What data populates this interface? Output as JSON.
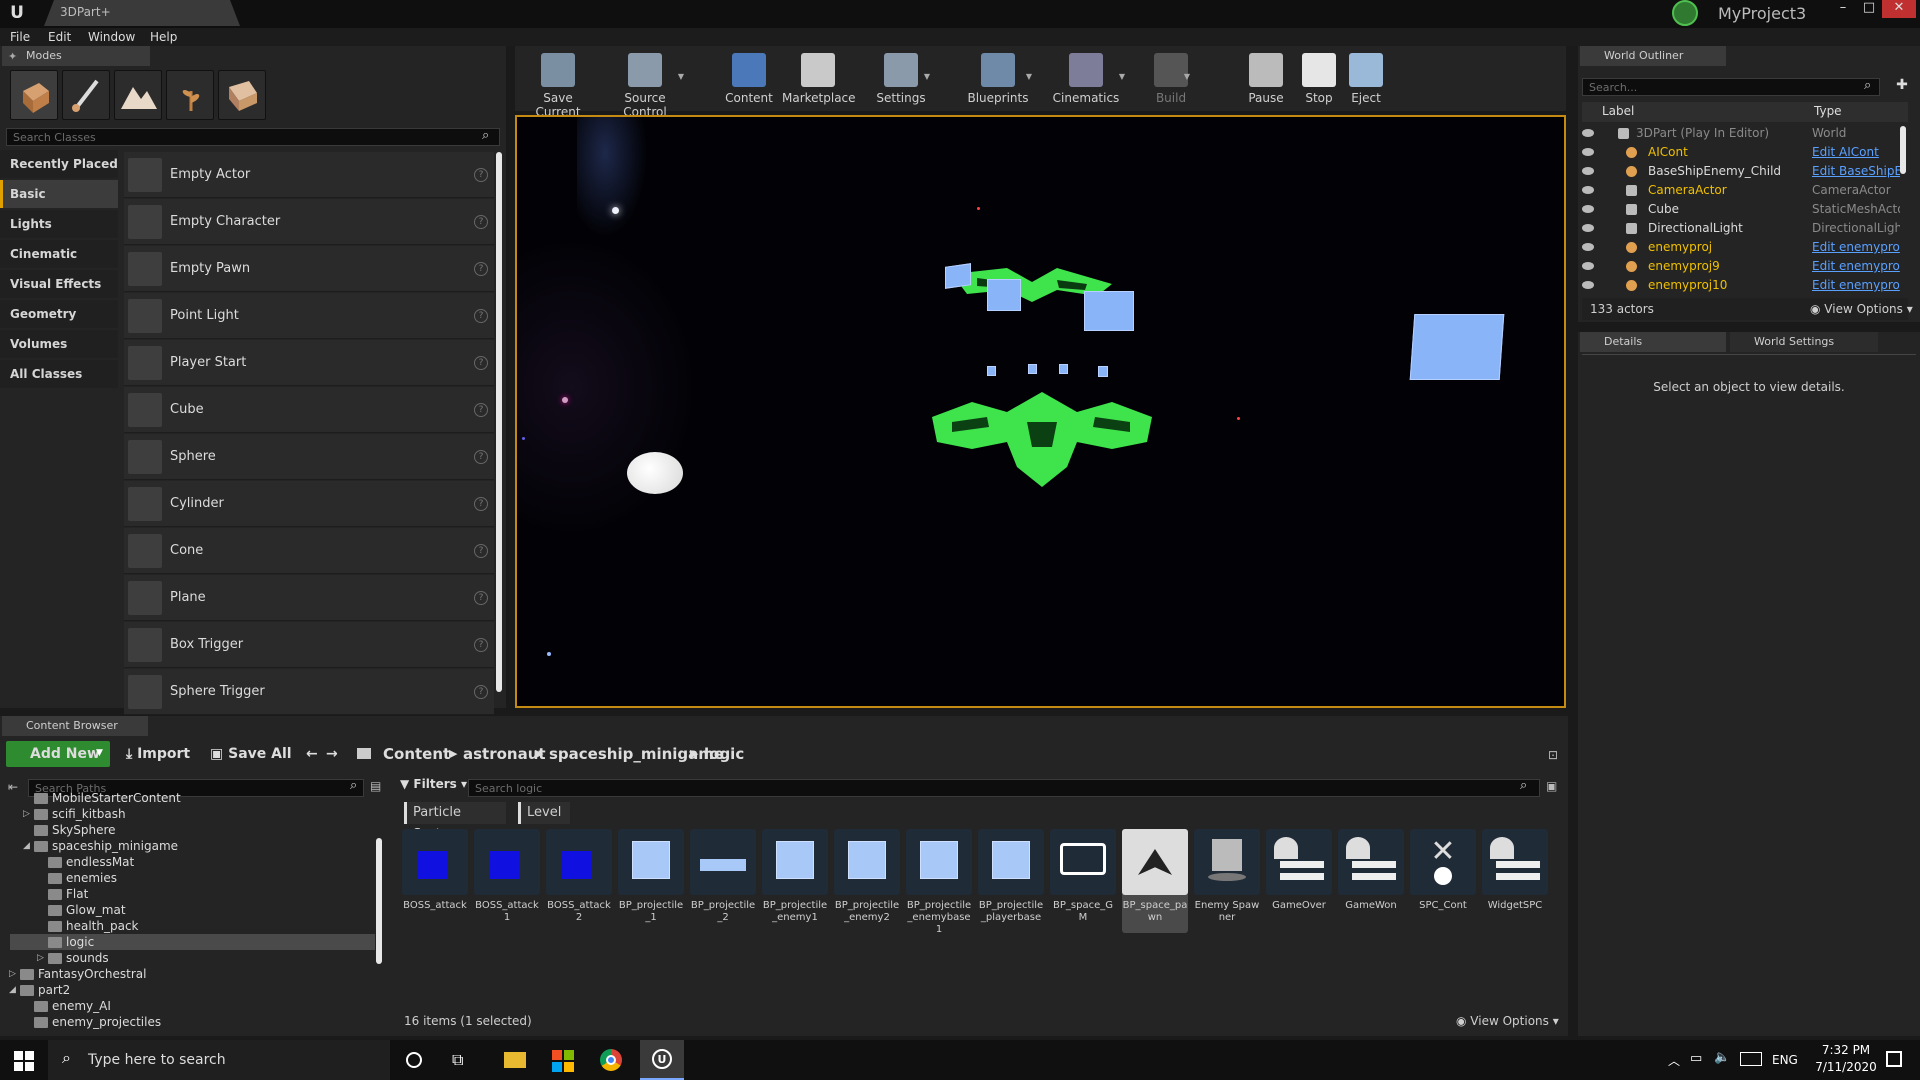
{
  "window": {
    "doc_tab": "3DPart+",
    "project_name": "MyProject3",
    "min": "–",
    "max": "□",
    "close": "✕"
  },
  "menu": [
    "File",
    "Edit",
    "Window",
    "Help"
  ],
  "modes": {
    "tab": "Modes",
    "search_placeholder": "Search Classes",
    "categories": [
      "Recently Placed",
      "Basic",
      "Lights",
      "Cinematic",
      "Visual Effects",
      "Geometry",
      "Volumes",
      "All Classes"
    ],
    "selected_category": "Basic",
    "classes": [
      "Empty Actor",
      "Empty Character",
      "Empty Pawn",
      "Point Light",
      "Player Start",
      "Cube",
      "Sphere",
      "Cylinder",
      "Cone",
      "Plane",
      "Box Trigger",
      "Sphere Trigger"
    ]
  },
  "toolbar": [
    "Save Current",
    "Source Control",
    "Content",
    "Marketplace",
    "Settings",
    "Blueprints",
    "Cinematics",
    "Build",
    "Pause",
    "Stop",
    "Eject"
  ],
  "outliner": {
    "tab": "World Outliner",
    "search_placeholder": "Search...",
    "col_label": "Label",
    "col_type": "Type",
    "rows": [
      {
        "label": "3DPart (Play In Editor)",
        "type": "World",
        "link": false,
        "color": "#8a8a8a"
      },
      {
        "label": "AICont",
        "type": "Edit AICont",
        "link": true,
        "color": "#f0c000"
      },
      {
        "label": "BaseShipEnemy_Child",
        "type": "Edit BaseShipE",
        "link": true,
        "color": "#dcdcdc"
      },
      {
        "label": "CameraActor",
        "type": "CameraActor",
        "link": false,
        "color": "#f0c000"
      },
      {
        "label": "Cube",
        "type": "StaticMeshActo",
        "link": false,
        "color": "#dcdcdc"
      },
      {
        "label": "DirectionalLight",
        "type": "DirectionalLight",
        "link": false,
        "color": "#dcdcdc"
      },
      {
        "label": "enemyproj",
        "type": "Edit enemypro",
        "link": true,
        "color": "#f0c000"
      },
      {
        "label": "enemyproj9",
        "type": "Edit enemypro",
        "link": true,
        "color": "#f0c000"
      },
      {
        "label": "enemyproj10",
        "type": "Edit enemypro",
        "link": true,
        "color": "#f0c000"
      }
    ],
    "actor_count": "133 actors",
    "view_options": "View Options"
  },
  "details": {
    "tab1": "Details",
    "tab2": "World Settings",
    "empty_message": "Select an object to view details."
  },
  "content_browser": {
    "tab": "Content Browser",
    "add_new": "Add New",
    "import": "Import",
    "save_all": "Save All",
    "breadcrumb": [
      "Content",
      "astronaut",
      "spaceship_minigame",
      "logic"
    ],
    "search_paths_placeholder": "Search Paths",
    "filters": "Filters",
    "search_placeholder": "Search logic",
    "filter_chips": [
      "Particle System",
      "Level"
    ],
    "tree": [
      {
        "label": "MobileStarterContent",
        "indent": 1
      },
      {
        "label": "scifi_kitbash",
        "indent": 1
      },
      {
        "label": "SkySphere",
        "indent": 1
      },
      {
        "label": "spaceship_minigame",
        "indent": 1
      },
      {
        "label": "endlessMat",
        "indent": 2
      },
      {
        "label": "enemies",
        "indent": 2
      },
      {
        "label": "Flat",
        "indent": 2
      },
      {
        "label": "Glow_mat",
        "indent": 2
      },
      {
        "label": "health_pack",
        "indent": 2
      },
      {
        "label": "logic",
        "indent": 2
      },
      {
        "label": "sounds",
        "indent": 2
      },
      {
        "label": "FantasyOrchestral",
        "indent": 0
      },
      {
        "label": "part2",
        "indent": 0
      },
      {
        "label": "enemy_AI",
        "indent": 1
      },
      {
        "label": "enemy_projectiles",
        "indent": 1
      }
    ],
    "assets": [
      {
        "label": "BOSS_attack",
        "kind": "boss"
      },
      {
        "label": "BOSS_attack1",
        "kind": "boss"
      },
      {
        "label": "BOSS_attack2",
        "kind": "boss"
      },
      {
        "label": "BP_projectile_1",
        "kind": "proj"
      },
      {
        "label": "BP_projectile_2",
        "kind": "flat"
      },
      {
        "label": "BP_projectile_enemy1",
        "kind": "proj"
      },
      {
        "label": "BP_projectile_enemy2",
        "kind": "proj"
      },
      {
        "label": "BP_projectile_enemybase1",
        "kind": "proj"
      },
      {
        "label": "BP_projectile_playerbase",
        "kind": "proj"
      },
      {
        "label": "BP_space_GM",
        "kind": "gm"
      },
      {
        "label": "BP_space_pawn",
        "kind": "pawn"
      },
      {
        "label": "Enemy Spawner",
        "kind": "spawner"
      },
      {
        "label": "GameOver",
        "kind": "widget"
      },
      {
        "label": "GameWon",
        "kind": "widget"
      },
      {
        "label": "SPC_Cont",
        "kind": "cont"
      },
      {
        "label": "WidgetSPC",
        "kind": "widget"
      }
    ],
    "selected_asset": "BP_space_pawn",
    "item_count": "16 items (1 selected)",
    "view_options": "View Options"
  },
  "taskbar": {
    "search_placeholder": "Type here to search",
    "lang": "ENG",
    "time": "7:32 PM",
    "date": "7/11/2020"
  },
  "colors": {
    "accent": "#c58a12",
    "add_new": "#2f8b2f",
    "link": "#5aa0ff",
    "ship": "#3fe34c",
    "cube": "#8ab4f8"
  }
}
